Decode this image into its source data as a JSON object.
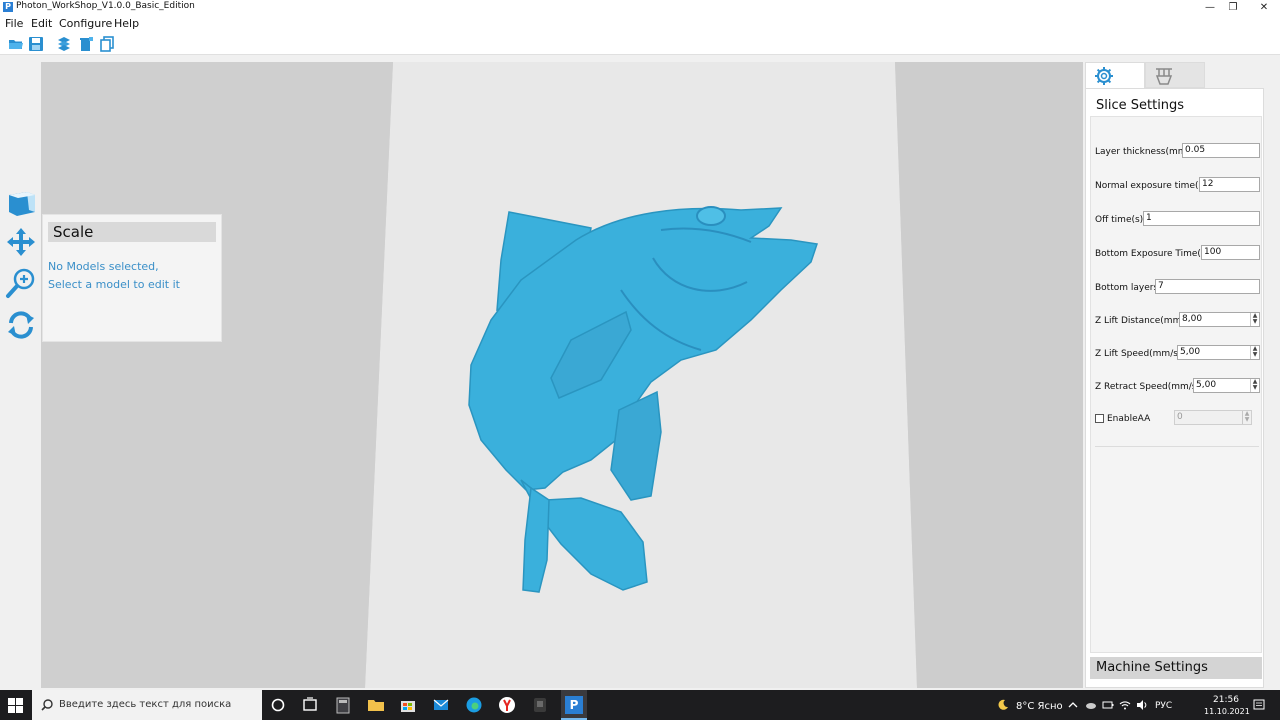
{
  "window": {
    "title": "Photon_WorkShop_V1.0.0_Basic_Edition",
    "app_icon_letter": "P",
    "minimize": "—",
    "restore": "❐",
    "close": "✕"
  },
  "menu": [
    "File",
    "Edit",
    "Configure",
    "Help"
  ],
  "toolbar_icons": [
    "open-folder-icon",
    "save-icon",
    "slice-layers-icon",
    "delete-model-icon",
    "copy-model-icon"
  ],
  "left_tools": [
    "view-cube-icon",
    "move-icon",
    "scale-icon",
    "rotate-icon"
  ],
  "scale_panel": {
    "title": "Scale",
    "line1": "No Models selected,",
    "line2": "Select a model to edit it"
  },
  "right_panel": {
    "tabs": [
      "settings-gear-icon",
      "machine-tab-icon"
    ],
    "title": "Slice Settings",
    "fields": [
      {
        "label": "Layer thickness(mm):",
        "value": "0.05"
      },
      {
        "label": "Normal exposure time(s):",
        "value": "12"
      },
      {
        "label": "Off time(s):",
        "value": "1"
      },
      {
        "label": "Bottom Exposure Time(s):",
        "value": "100"
      },
      {
        "label": "Bottom layers:",
        "value": "7"
      },
      {
        "label": "Z Lift Distance(mm):",
        "value": "8,00"
      },
      {
        "label": "Z Lift Speed(mm/s):",
        "value": "5,00"
      },
      {
        "label": "Z Retract Speed(mm/s):",
        "value": "5,00"
      }
    ],
    "enable_aa": {
      "label": "EnableAA",
      "value": "0",
      "checked": false
    },
    "machine_settings": "Machine Settings"
  },
  "model": {
    "color": "#3ab0dc"
  },
  "taskbar": {
    "search_placeholder": "Введите здесь текст для поиска",
    "weather": "8°C Ясно",
    "lang": "РУС",
    "time": "21:56",
    "date": "11.10.2021"
  },
  "colors": {
    "accent": "#2a8fd0",
    "viewport_floor": "#e8e8e8",
    "taskbar": "#1d1d1f"
  }
}
